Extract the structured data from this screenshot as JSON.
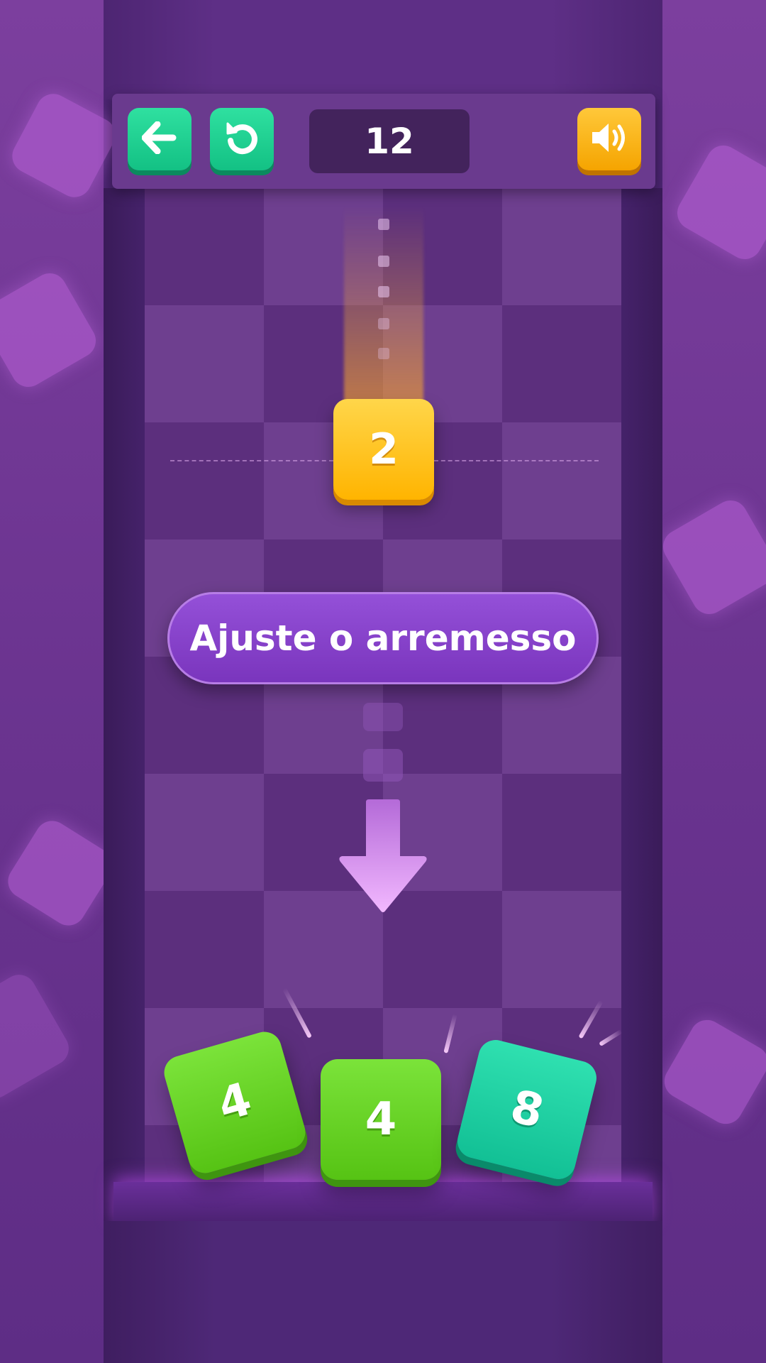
{
  "header": {
    "score": "12",
    "back_icon": "arrow-left-icon",
    "restart_icon": "restart-icon",
    "sound_icon": "speaker-icon"
  },
  "falling_tile": {
    "value": "2",
    "color": "#ffb400"
  },
  "hint": {
    "text": "Ajuste o arremesso"
  },
  "stack_tiles": [
    {
      "value": "4",
      "color": "#56c314"
    },
    {
      "value": "4",
      "color": "#56c314"
    },
    {
      "value": "8",
      "color": "#12c095"
    }
  ],
  "colors": {
    "background": "#5a2c80",
    "green_button": "#13c184",
    "yellow_button": "#f5a400",
    "hint_pill": "#7a35bd"
  }
}
